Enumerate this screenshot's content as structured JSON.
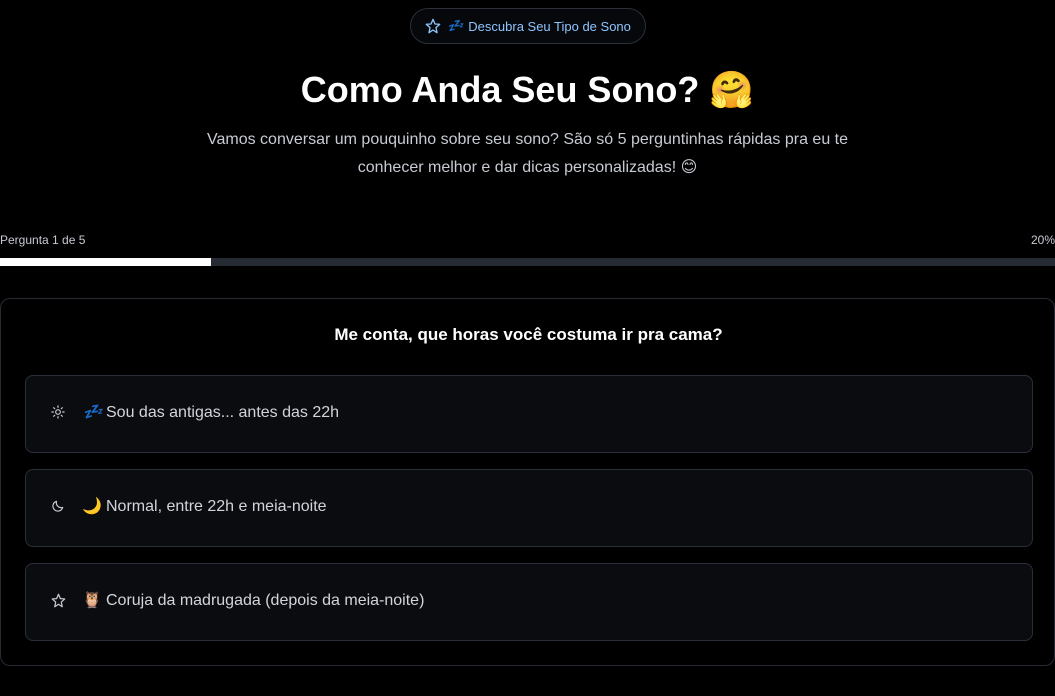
{
  "badge": {
    "icon": "star-icon",
    "emoji": "💤",
    "label": "Descubra Seu Tipo de Sono"
  },
  "header": {
    "title": "Como Anda Seu Sono?",
    "title_emoji": "🤗",
    "subtitle_line1": "Vamos conversar um pouquinho sobre seu sono? São só 5 perguntinhas rápidas pra eu te",
    "subtitle_line2": "conhecer melhor e dar dicas personalizadas! 😊"
  },
  "progress": {
    "label": "Pergunta 1 de 5",
    "percent_text": "20%",
    "fraction": 0.2
  },
  "quiz": {
    "question": "Me conta, que horas você costuma ir pra cama?",
    "options": [
      {
        "icon": "sun-icon",
        "emoji": "💤",
        "label": "Sou das antigas... antes das 22h"
      },
      {
        "icon": "moon-icon",
        "emoji": "🌙",
        "label": "Normal, entre 22h e meia-noite"
      },
      {
        "icon": "star-icon",
        "emoji": "🦉",
        "label": "Coruja da madrugada (depois da meia-noite)"
      }
    ]
  },
  "colors": {
    "background": "#000000",
    "accent": "#8ec5ff",
    "progress_fill": "#ffffff",
    "progress_track": "#262a33"
  }
}
